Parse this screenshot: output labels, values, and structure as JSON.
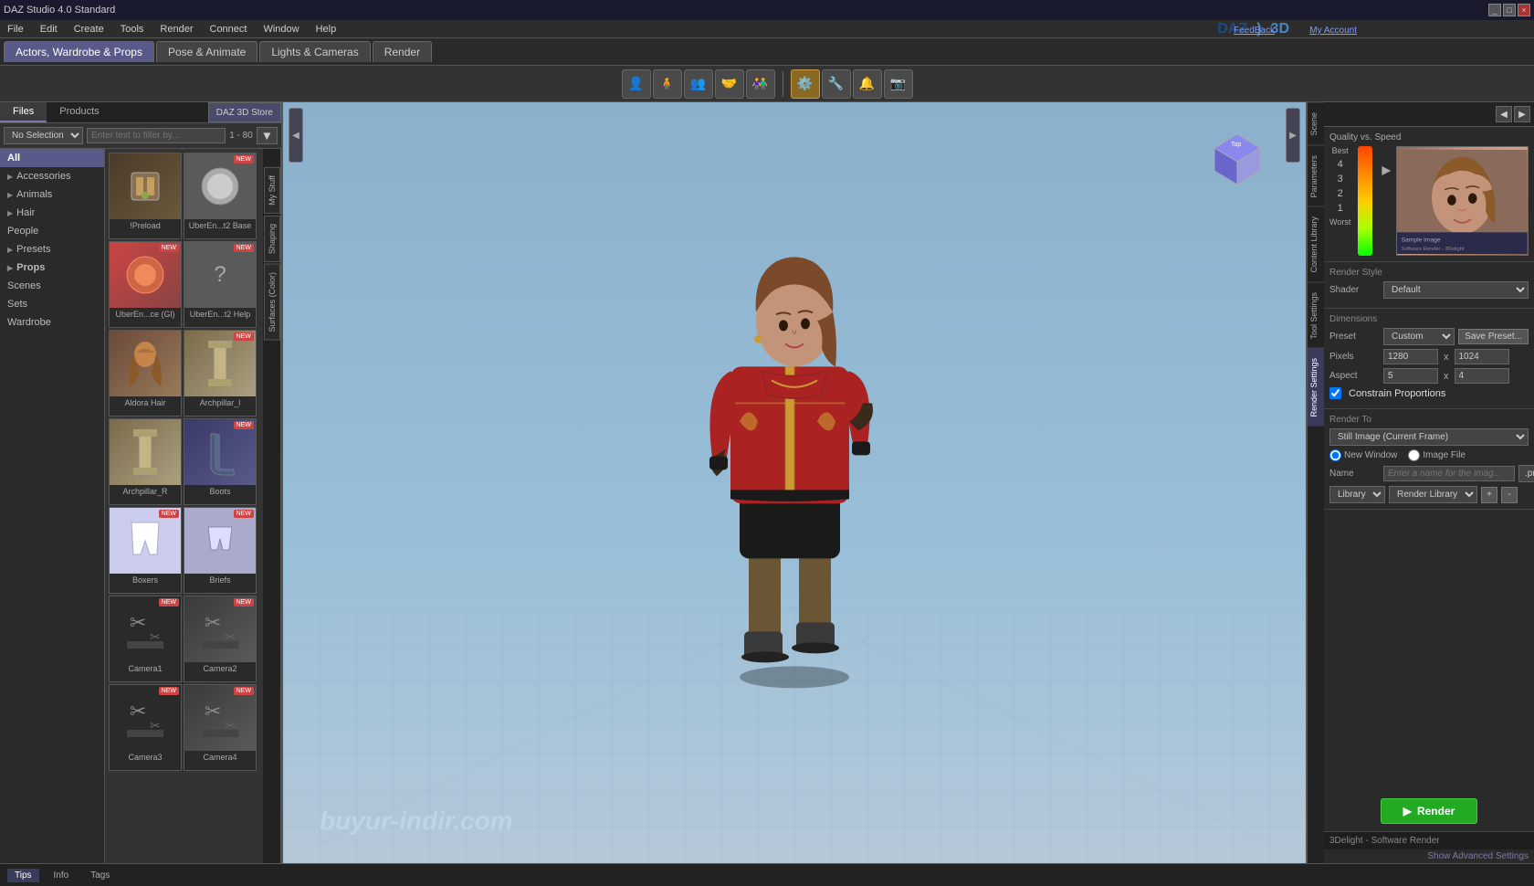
{
  "app": {
    "title": "DAZ Studio 4.0 Standard",
    "window_controls": [
      "_",
      "□",
      "×"
    ]
  },
  "menubar": {
    "items": [
      "File",
      "Edit",
      "Create",
      "Tools",
      "Render",
      "Connect",
      "Window",
      "Help"
    ]
  },
  "navtabs": [
    {
      "id": "actors",
      "label": "Actors, Wardrobe & Props",
      "active": true
    },
    {
      "id": "pose",
      "label": "Pose & Animate",
      "active": false
    },
    {
      "id": "lights",
      "label": "Lights & Cameras",
      "active": false
    },
    {
      "id": "render",
      "label": "Render",
      "active": false
    }
  ],
  "toolbar": {
    "groups": [
      {
        "btns": [
          "👤",
          "🧍",
          "👥",
          "🤝",
          "👫"
        ]
      },
      {
        "btns": [
          "⚙️",
          "🔧",
          "🔔",
          "📷"
        ]
      }
    ]
  },
  "leftpanel": {
    "tabs": [
      "Files",
      "Products"
    ],
    "active_tab": "Files",
    "store_btn": "DAZ 3D Store",
    "sel_dropdown": "No Selection",
    "filter_placeholder": "Enter text to filter by...",
    "page_info": "1 - 80",
    "categories": [
      {
        "label": "All",
        "active": true,
        "bold": true
      },
      {
        "label": "Accessories",
        "has_arrow": true
      },
      {
        "label": "Animals",
        "has_arrow": true
      },
      {
        "label": "Hair",
        "has_arrow": true
      },
      {
        "label": "People",
        "active": false
      },
      {
        "label": "Presets",
        "has_arrow": true
      },
      {
        "label": "Props",
        "has_arrow": true,
        "bold": true
      },
      {
        "label": "Scenes"
      },
      {
        "label": "Sets"
      },
      {
        "label": "Wardrobe"
      }
    ],
    "grid_items": [
      {
        "label": "!Preload",
        "new": false,
        "color": "#4a3a2a"
      },
      {
        "label": "UberEn...t2 Base",
        "new": true,
        "color": "#5a5a5a"
      },
      {
        "label": "UberEn...ce (Gl)",
        "new": true,
        "color": "#cc4444"
      },
      {
        "label": "UberEn...t2 Help",
        "new": true,
        "color": "#5a5a5a"
      },
      {
        "label": "Aldora Hair",
        "new": false,
        "color": "#8a6a5a"
      },
      {
        "label": "Archpillar_l",
        "new": true,
        "color": "#7a6a4a"
      },
      {
        "label": "Archpillar_R",
        "new": false,
        "color": "#7a6a4a"
      },
      {
        "label": "Boots",
        "new": true,
        "color": "#3a3a6a"
      },
      {
        "label": "Boxers",
        "new": true,
        "color": "#ccccee"
      },
      {
        "label": "Briefs",
        "new": true,
        "color": "#aaaacc"
      },
      {
        "label": "Camera1",
        "new": true,
        "color": "#3a3a3a"
      },
      {
        "label": "Camera2",
        "new": true,
        "color": "#3a3a3a"
      },
      {
        "label": "Camera3",
        "new": true,
        "color": "#3a3a3a"
      },
      {
        "label": "Camera4",
        "new": true,
        "color": "#3a3a3a"
      }
    ]
  },
  "sidetabs": [
    "My Stuff",
    "Shaping",
    "Surfaces (Color)"
  ],
  "viewport": {
    "watermark": "buyur-indir.com"
  },
  "rightpanel": {
    "tabs": [
      "Scene",
      "Parameters",
      "Content Library",
      "Tool Settings",
      "Render Settings"
    ],
    "active_tab": "Render Settings",
    "header_icons": [
      "◀",
      "▶"
    ],
    "qvs": {
      "title": "Quality vs. Speed",
      "best_label": "Best",
      "worst_label": "Worst",
      "numbers": [
        "4",
        "3",
        "2",
        "1"
      ],
      "sample_text": "Sample Image",
      "render_engine": "Software Render - 3Delight"
    },
    "render_style": {
      "title": "Render Style",
      "shader_label": "Shader",
      "shader_value": "Default"
    },
    "dimensions": {
      "title": "Dimensions",
      "preset_label": "Preset",
      "preset_value": "Custom",
      "save_preset_btn": "Save Preset...",
      "pixels_label": "Pixels",
      "pixels_w": "1280",
      "pixels_h": "1024",
      "x_sep": "x",
      "aspect_label": "Aspect",
      "aspect_w": "5",
      "aspect_h": "4",
      "constrain_label": "Constrain Proportions"
    },
    "render_to": {
      "title": "Render To",
      "dropdown_value": "Still Image (Current Frame)",
      "radio1": "New Window",
      "radio2": "Image File",
      "name_label": "Name",
      "name_placeholder": "Enter a name for the imag...",
      "ext_value": ".png",
      "lib_label": "Library",
      "lib_value": "Library",
      "lib2_value": "Render Library",
      "add_btn": "+",
      "remove_btn": "-"
    },
    "render_btn": "Render",
    "footer_text": "3Delight - Software Render",
    "show_advanced": "Show Advanced Settings"
  },
  "daz_logo": {
    "text1": "DAZ",
    "sep": ")",
    "text2": "3D"
  },
  "top_links": {
    "feedback": "FeedBack",
    "account": "My Account"
  },
  "bottombar": {
    "tabs": [
      "Tips",
      "Info",
      "Tags"
    ]
  }
}
